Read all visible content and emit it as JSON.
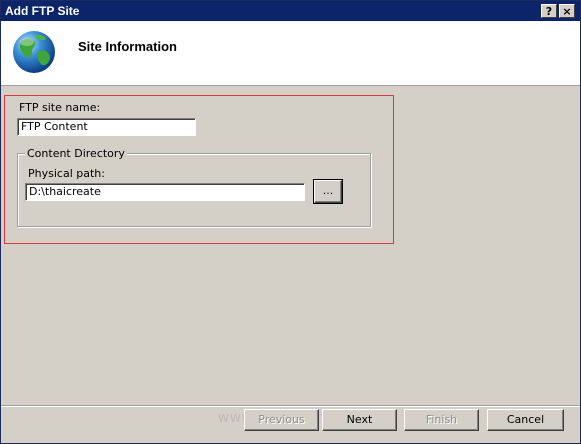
{
  "window": {
    "title": "Add FTP Site"
  },
  "titlebar_buttons": {
    "help": "?",
    "close": "×"
  },
  "header": {
    "title": "Site Information",
    "icon": "globe-icon"
  },
  "form": {
    "site_name_label": "FTP site name:",
    "site_name_value": "FTP Content",
    "content_dir_title": "Content Directory",
    "physical_path_label": "Physical path:",
    "physical_path_value": "D:\\thaicreate",
    "browse_label": "..."
  },
  "footer": {
    "previous_label": "Previous",
    "next_label": "Next",
    "finish_label": "Finish",
    "cancel_label": "Cancel",
    "watermark": "WWW.THAICREATE.COM"
  },
  "colors": {
    "titlebar": "#0b246a",
    "highlight_border": "#d83a3a",
    "dialog_bg": "#d4d0c8"
  }
}
